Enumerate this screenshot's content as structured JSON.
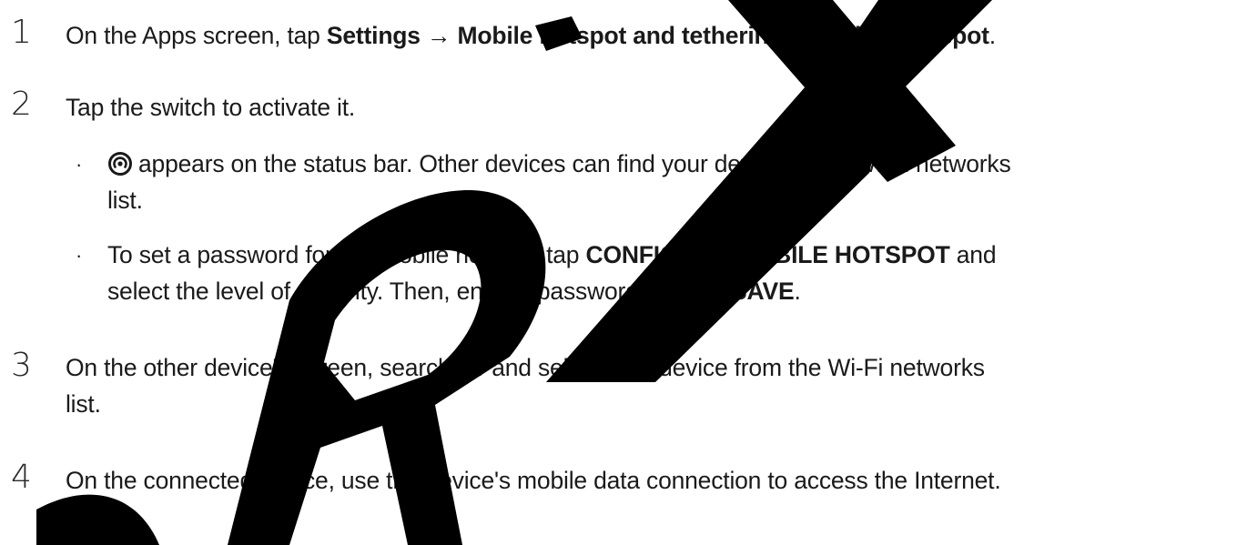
{
  "steps": [
    {
      "number": "1",
      "text_before": "On the Apps screen, tap ",
      "bold_1": "Settings",
      "arrow_1": " → ",
      "bold_2": "Mobile hotspot and tethering",
      "arrow_2": " → ",
      "bold_3": "Mobile hotspot",
      "text_after": "."
    },
    {
      "number": "2",
      "text": "Tap the switch to activate it.",
      "bullets": [
        {
          "icon": "hotspot-icon",
          "line1": "appears on the status bar. Other devices can find your device in the Wi-Fi networks",
          "line2": "list."
        },
        {
          "line1_before": "To set a password for the mobile hotspot, tap ",
          "line1_bold": "CONFIGURE MOBILE HOTSPOT",
          "line1_after": " and",
          "line2_before": "select the level of security. Then, enter a password and tap ",
          "line2_bold": "SAVE",
          "line2_after": "."
        }
      ]
    },
    {
      "number": "3",
      "line1": "On the other device's screen, search for and select your device from the Wi-Fi networks",
      "line2": "list."
    },
    {
      "number": "4",
      "text": "On the connected device, use the device's mobile data connection to access the Internet."
    }
  ],
  "watermark": {
    "text": "DRAFT",
    "color": "#000000"
  },
  "bullet_glyph": "·"
}
